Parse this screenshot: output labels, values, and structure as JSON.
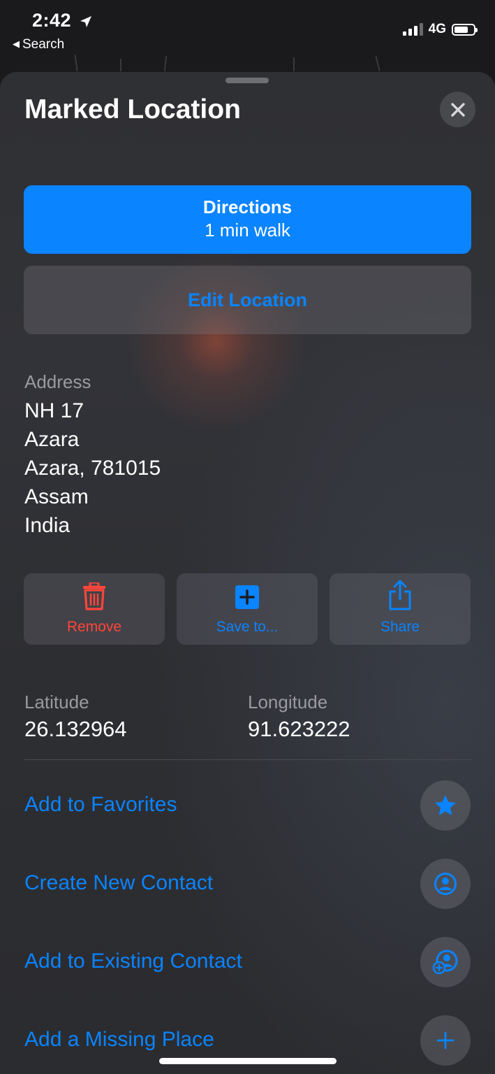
{
  "status_bar": {
    "time": "2:42",
    "back_label": "Search",
    "network": "4G"
  },
  "sheet": {
    "title": "Marked Location",
    "directions": {
      "title": "Directions",
      "subtitle": "1 min walk"
    },
    "edit_label": "Edit Location",
    "address": {
      "label": "Address",
      "lines": [
        "NH 17",
        "Azara",
        "Azara, 781015",
        "Assam",
        "India"
      ]
    },
    "actions": [
      {
        "label": "Remove",
        "icon": "trash-icon",
        "color": "#ff453a"
      },
      {
        "label": "Save to...",
        "icon": "plus-square-icon",
        "color": "#0a84ff"
      },
      {
        "label": "Share",
        "icon": "share-icon",
        "color": "#0a84ff"
      }
    ],
    "coordinates": {
      "latitude_label": "Latitude",
      "latitude": "26.132964",
      "longitude_label": "Longitude",
      "longitude": "91.623222"
    },
    "rows": [
      {
        "label": "Add to Favorites",
        "icon": "star-icon"
      },
      {
        "label": "Create New Contact",
        "icon": "person-circle-icon"
      },
      {
        "label": "Add to Existing Contact",
        "icon": "add-contact-icon"
      },
      {
        "label": "Add a Missing Place",
        "icon": "plus-icon"
      }
    ]
  },
  "colors": {
    "accent": "#0a84ff",
    "destructive": "#ff453a"
  }
}
